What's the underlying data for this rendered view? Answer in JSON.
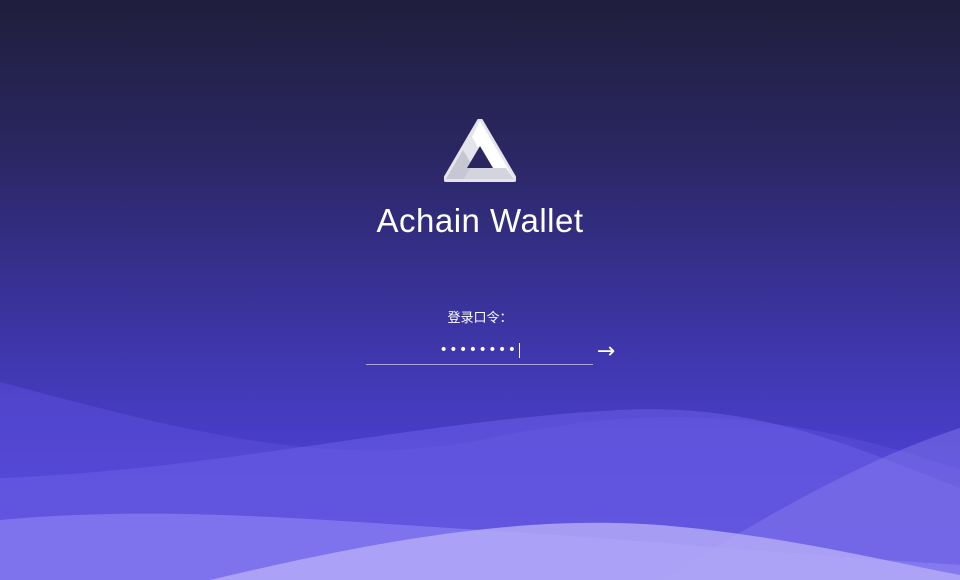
{
  "app": {
    "title": "Achain Wallet",
    "logo_icon": "achain-triangle-logo-icon"
  },
  "login": {
    "label": "登录口令：",
    "password_masked": "••••••••",
    "password_length": 8,
    "submit_label": "→",
    "submit_icon": "arrow-right-icon"
  },
  "colors": {
    "bg_top": "#1f1e3c",
    "bg_bottom": "#5a4ae0",
    "text": "#ffffff"
  }
}
